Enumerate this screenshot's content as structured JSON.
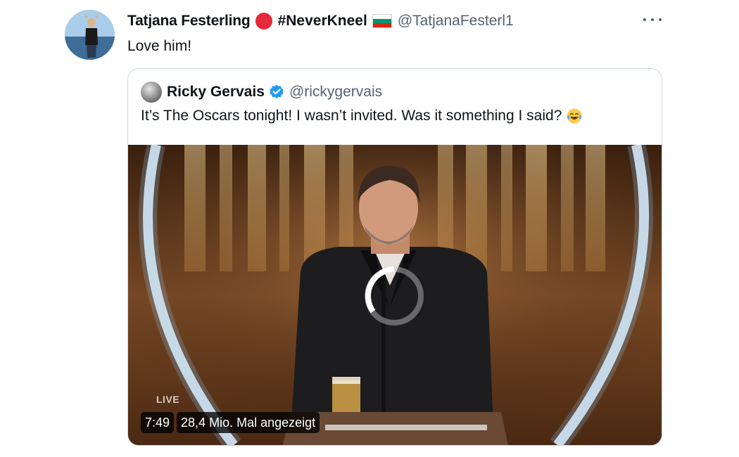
{
  "tweet": {
    "author_name": "Tatjana Festerling",
    "hashtag": "#NeverKneel",
    "handle": "@TatjanaFesterl1",
    "text": "Love him!"
  },
  "quoted": {
    "author_name": "Ricky Gervais",
    "handle": "@rickygervais",
    "text": "It’s The Oscars tonight! I wasn’t invited. Was it something I said?",
    "video": {
      "duration": "7:49",
      "views": "28,4 Mio. Mal angezeigt",
      "live_label": "LIVE"
    }
  },
  "colors": {
    "red_dot": "#e6283b",
    "verified": "#1d9bf0",
    "secondary_text": "#536471",
    "flag": [
      "#ffffff",
      "#00966e",
      "#d62612"
    ]
  }
}
